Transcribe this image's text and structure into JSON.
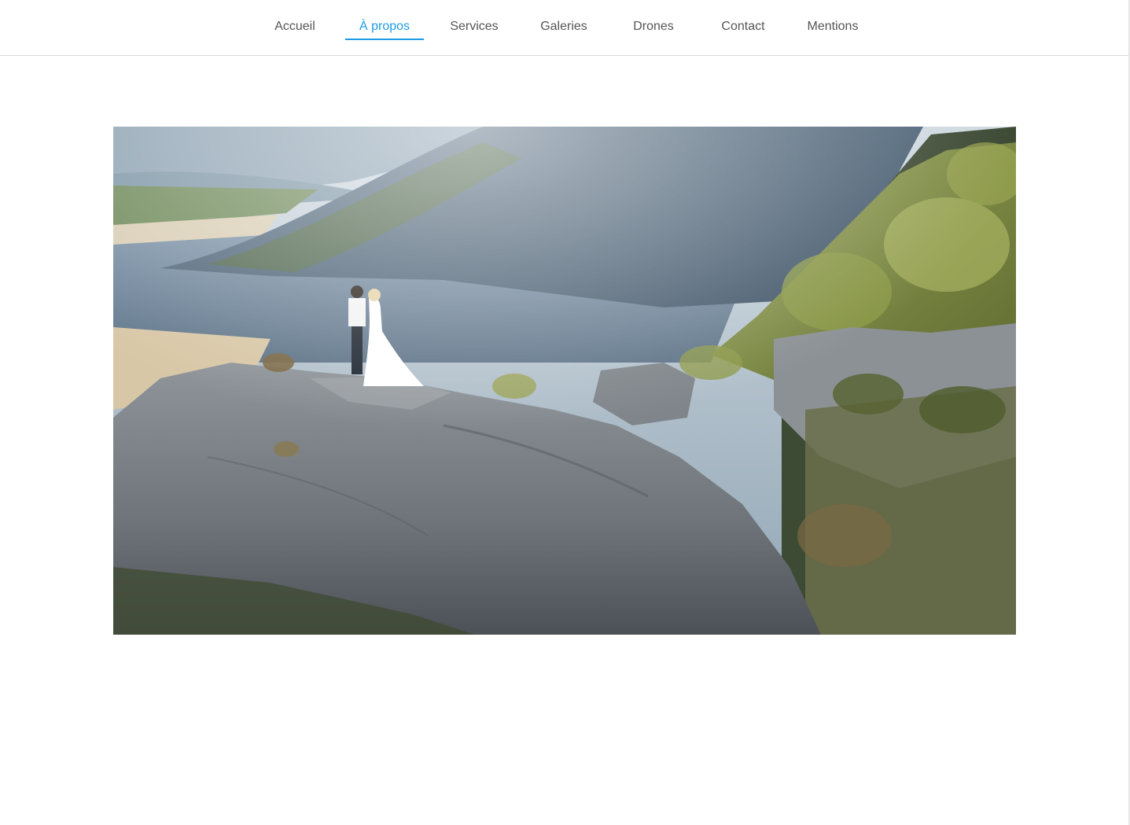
{
  "nav": {
    "items": [
      {
        "label": "Accueil",
        "active": false
      },
      {
        "label": "À propos",
        "active": true
      },
      {
        "label": "Services",
        "active": false
      },
      {
        "label": "Galeries",
        "active": false
      },
      {
        "label": "Drones",
        "active": false
      },
      {
        "label": "Contact",
        "active": false
      },
      {
        "label": "Mentions",
        "active": false
      }
    ],
    "accent_color": "#1e9be6",
    "text_color": "#555555"
  },
  "hero": {
    "kind": "video-still",
    "icon": "landscape-photo-icon"
  }
}
